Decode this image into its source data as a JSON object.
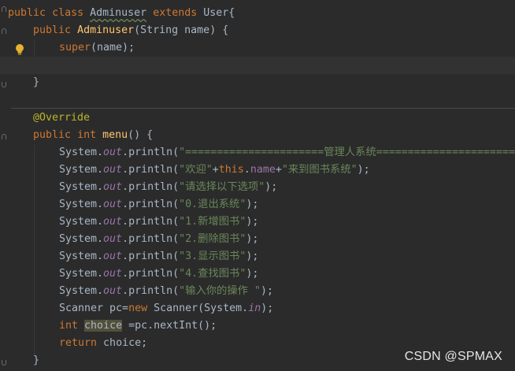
{
  "code": {
    "line1": {
      "kw1": "public",
      "kw2": "class",
      "cls": "Adminuser",
      "kw3": "extends",
      "parent": "User",
      "brace": "{"
    },
    "line2": {
      "kw": "public",
      "ctor": "Adminuser",
      "params": "(String name) {"
    },
    "line3": {
      "call": "super",
      "args": "(name);"
    },
    "line5": {
      "brace": "}"
    },
    "line6": {
      "annotation": "@Override"
    },
    "line7": {
      "kw1": "public",
      "kw2": "int",
      "method": "menu",
      "rest": "() {"
    },
    "println_lines": [
      {
        "prefix": "System.",
        "field": "out",
        "call": ".println(",
        "str": "\"======================管理人系统======================",
        "end": ""
      },
      {
        "prefix": "System.",
        "field": "out",
        "call": ".println(",
        "str": "\"欢迎\"",
        "end": ""
      },
      {
        "prefix": "System.",
        "field": "out",
        "call": ".println(",
        "str": "\"请选择以下选项\"",
        "end": ");"
      },
      {
        "prefix": "System.",
        "field": "out",
        "call": ".println(",
        "str": "\"0.退出系统\"",
        "end": ");"
      },
      {
        "prefix": "System.",
        "field": "out",
        "call": ".println(",
        "str": "\"1.新增图书\"",
        "end": ");"
      },
      {
        "prefix": "System.",
        "field": "out",
        "call": ".println(",
        "str": "\"2.删除图书\"",
        "end": ");"
      },
      {
        "prefix": "System.",
        "field": "out",
        "call": ".println(",
        "str": "\"3.显示图书\"",
        "end": ");"
      },
      {
        "prefix": "System.",
        "field": "out",
        "call": ".println(",
        "str": "\"4.查找图书\"",
        "end": ");"
      },
      {
        "prefix": "System.",
        "field": "out",
        "call": ".println(",
        "str": "\"输入你的操作 \"",
        "end": ");"
      }
    ],
    "line2_extra": {
      "plus1": "+",
      "this": "this",
      "dot": ".",
      "name": "name",
      "plus2": "+",
      "str2": "\"来到图书系统\"",
      "end": ");"
    },
    "scanner_line": {
      "type": "Scanner pc=",
      "kw": "new",
      "rest1": " Scanner(System.",
      "field": "in",
      "rest2": ");"
    },
    "choice_line": {
      "kw": "int",
      "var": "choice",
      "rest": " =pc.nextInt();"
    },
    "return_line": {
      "kw": "return",
      "rest": " choice;"
    },
    "closing_brace": "}"
  },
  "watermark": "CSDN @SPMAX",
  "colors": {
    "background": "#2b2b2b",
    "keyword": "#cc7832",
    "function": "#ffc66d",
    "string": "#6a8759",
    "field": "#9876aa",
    "annotation": "#bbb529",
    "text": "#a9b7c6"
  },
  "icons": {
    "gutter": "lightbulb-icon"
  }
}
